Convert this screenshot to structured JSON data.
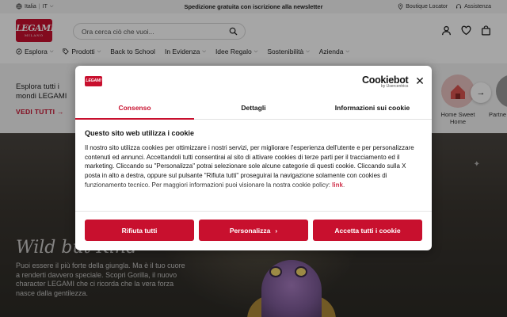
{
  "topbar": {
    "country": "Italia",
    "language": "IT",
    "promo": "Spedizione gratuita con iscrizione alla newsletter",
    "store_locator": "Boutique Locator",
    "support": "Assistenza"
  },
  "header": {
    "logo_text": "LEGAMI",
    "logo_sub": "MILANO",
    "search_placeholder": "Ora cerca ciò che vuoi..."
  },
  "nav": {
    "items": [
      {
        "label": "Esplora",
        "icon": "compass-icon"
      },
      {
        "label": "Prodotti",
        "icon": "tag-icon"
      },
      {
        "label": "Back to School"
      },
      {
        "label": "In Evidenza"
      },
      {
        "label": "Idee Regalo"
      },
      {
        "label": "Sostenibilità"
      },
      {
        "label": "Azienda"
      }
    ]
  },
  "strip": {
    "line1": "Esplora tutti i",
    "line2": "mondi LEGAMI",
    "cta": "VEDI TUTTI",
    "categories": [
      {
        "label": "Home Sweet Home",
        "color": "#d9534f"
      },
      {
        "label": "Partne",
        "color": "#6b6b6b"
      }
    ]
  },
  "hero": {
    "title": "Wild but Kind",
    "description": "Puoi essere il più forte della giungla. Ma è il tuo cuore a renderti davvero speciale. Scopri Gorilla, il nuovo character LEGAMI che ci ricorda che la vera forza nasce dalla gentilezza."
  },
  "dialog": {
    "brand": "Cookiebot",
    "brand_by": "by Usercentrics",
    "tabs": [
      {
        "label": "Consenso",
        "active": true
      },
      {
        "label": "Dettagli",
        "active": false
      },
      {
        "label": "Informazioni sui cookie",
        "active": false
      }
    ],
    "heading": "Questo sito web utilizza i cookie",
    "body": "Il nostro sito utilizza cookies per ottimizzare i nostri servizi, per migliorare l'esperienza dell'utente e per personalizzare contenuti ed annunci. Accettandoli tutti consentirai al sito di attivare cookies di terze parti per il tracciamento ed il marketing. Cliccando su \"Personalizza\" potrai selezionare sole alcune categorie di questi cookie. Cliccando sulla X posta in alto a destra, oppure sul pulsante \"Rifiuta tutti\" proseguirai la navigazione solamente con cookies di funzionamento tecnico. Per maggiori informazioni puoi visionare la nostra cookie policy:",
    "link": "link",
    "buttons": {
      "reject": "Rifiuta tutti",
      "customize": "Personalizza",
      "accept": "Accetta tutti i cookie"
    }
  },
  "colors": {
    "brand_red": "#c8102e"
  }
}
